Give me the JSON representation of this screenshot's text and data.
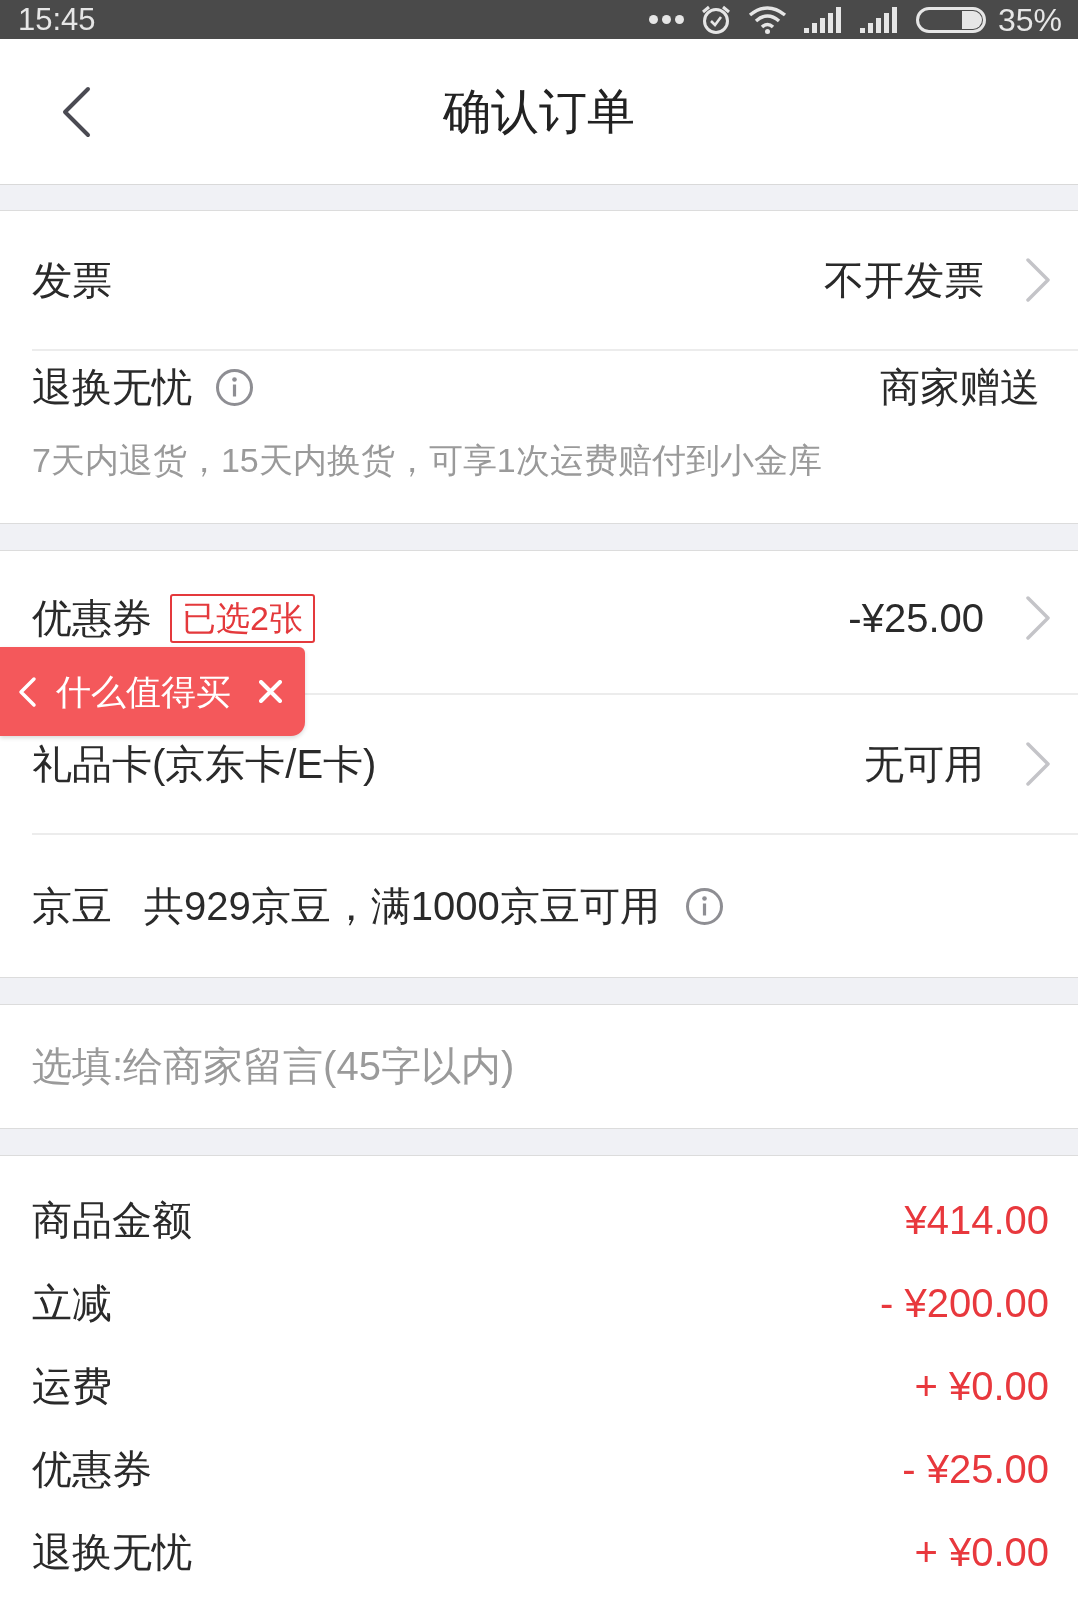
{
  "status_bar": {
    "time": "15:45",
    "battery": "35%"
  },
  "header": {
    "title": "确认订单"
  },
  "sections": [
    {
      "kind": "rows",
      "rows": [
        {
          "kind": "link",
          "label": "发票",
          "value": "不开发票"
        },
        {
          "kind": "info",
          "label": "退换无忧",
          "value": "商家赠送",
          "note": "7天内退货，15天内换货，可享1次运费赔付到小金库"
        }
      ]
    },
    {
      "kind": "rows",
      "rows": [
        {
          "kind": "coupon",
          "label": "优惠券",
          "badge": "已选2张",
          "value": "-¥25.00"
        },
        {
          "kind": "link",
          "label": "礼品卡(京东卡/E卡)",
          "value": "无可用"
        },
        {
          "kind": "beans",
          "label": "京豆",
          "detail": "共929京豆，满1000京豆可用"
        }
      ]
    },
    {
      "kind": "message",
      "placeholder": "选填:给商家留言(45字以内)"
    },
    {
      "kind": "summary",
      "items": [
        {
          "label": "商品金额",
          "value": "¥414.00"
        },
        {
          "label": "立减",
          "value": "- ¥200.00"
        },
        {
          "label": "运费",
          "value": "+ ¥0.00"
        },
        {
          "label": "优惠券",
          "value": "- ¥25.00"
        },
        {
          "label": "退换无忧",
          "value": "+ ¥0.00"
        }
      ]
    }
  ],
  "floating_tab": {
    "label": "什么值得买"
  }
}
